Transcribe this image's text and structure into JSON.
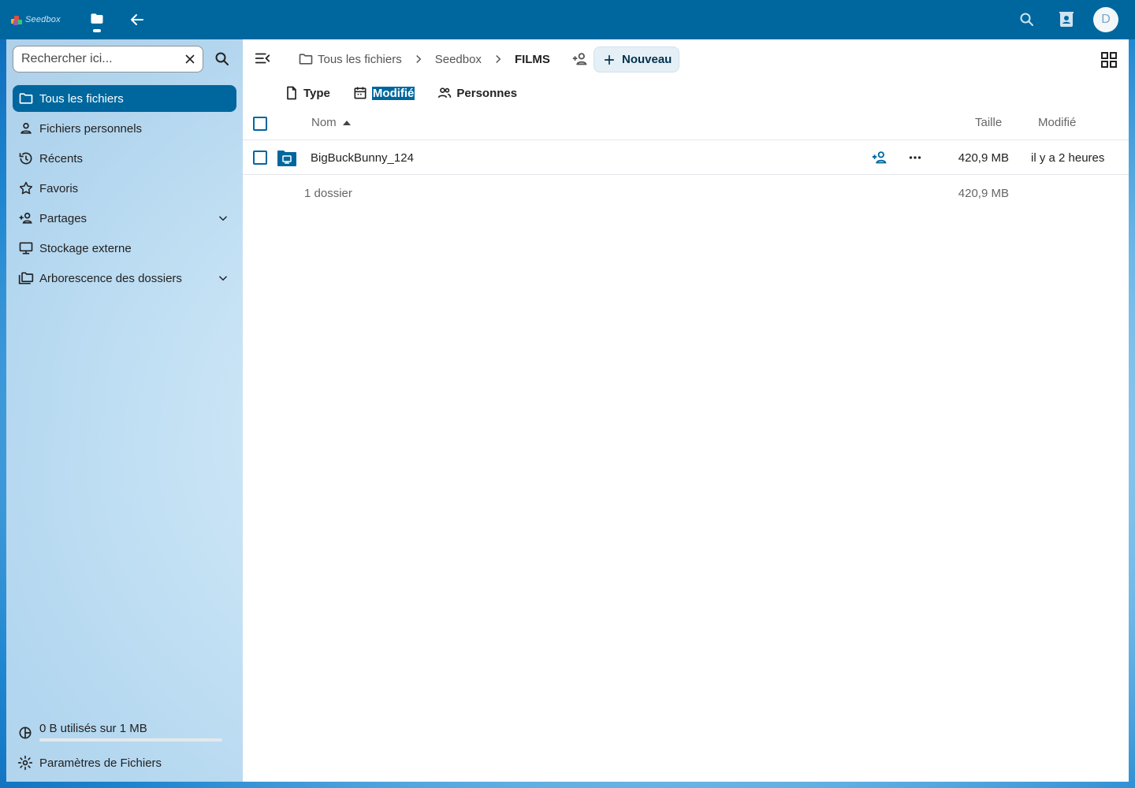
{
  "app": {
    "logo_text": "Seedbox",
    "avatar_initial": "D",
    "colors": {
      "primary": "#00679e",
      "header": "#00679e",
      "selected_bg": "#00679e"
    },
    "icons": [
      "files-icon",
      "back-arrow-icon",
      "search-icon",
      "contacts-icon"
    ]
  },
  "sidebar": {
    "search": {
      "placeholder": "Rechercher ici...",
      "value": ""
    },
    "items": [
      {
        "label": "Tous les fichiers",
        "icon": "folder-icon",
        "active": true
      },
      {
        "label": "Fichiers personnels",
        "icon": "account-icon"
      },
      {
        "label": "Récents",
        "icon": "history-icon"
      },
      {
        "label": "Favoris",
        "icon": "star-icon"
      },
      {
        "label": "Partages",
        "icon": "share-icon",
        "expandable": true
      },
      {
        "label": "Stockage externe",
        "icon": "external-storage-icon"
      },
      {
        "label": "Arborescence des dossiers",
        "icon": "folder-tree-icon",
        "expandable": true
      }
    ],
    "quota": {
      "label": "0 B utilisés sur 1 MB",
      "fraction": 0.0
    },
    "settings_label": "Paramètres de Fichiers"
  },
  "breadcrumb": {
    "items": [
      "Tous les fichiers",
      "Seedbox",
      "FILMS"
    ]
  },
  "toolbar": {
    "new_label": "Nouveau"
  },
  "filters": [
    {
      "label": "Type",
      "icon": "file-icon"
    },
    {
      "label": "Modifié",
      "icon": "calendar-icon",
      "selected": true
    },
    {
      "label": "Personnes",
      "icon": "people-icon"
    }
  ],
  "table": {
    "columns": {
      "name": "Nom",
      "size": "Taille",
      "modified": "Modifié"
    },
    "rows": [
      {
        "name": "BigBuckBunny_124",
        "size": "420,9 MB",
        "modified": "il y a 2 heures",
        "icon": "external-folder-icon"
      }
    ],
    "summary": {
      "count": "1 dossier",
      "total_size": "420,9 MB"
    }
  }
}
